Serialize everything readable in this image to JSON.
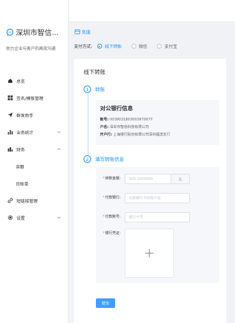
{
  "sidebar": {
    "brand_name": "深圳市智信...",
    "brand_sub": "助力企业与客户的高效沟通",
    "items": [
      {
        "label": "总览"
      },
      {
        "label": "签名/模板管理"
      },
      {
        "label": "群发助手"
      },
      {
        "label": "业务统计"
      },
      {
        "label": "财务"
      },
      {
        "label": "余额"
      },
      {
        "label": "日账单"
      },
      {
        "label": "短链接管理"
      },
      {
        "label": "设置"
      }
    ]
  },
  "breadcrumb": "充值",
  "payment": {
    "label": "支付方式:",
    "options": [
      {
        "label": "线下转账",
        "selected": true
      },
      {
        "label": "微信",
        "selected": false
      },
      {
        "label": "支付宝",
        "selected": false
      }
    ]
  },
  "card": {
    "title": "线下转账",
    "step1": {
      "num": "1",
      "label": "转账"
    },
    "bank": {
      "title": "对公银行信息",
      "account_label": "账号:",
      "account_value": "0039031803003970077",
      "name_label": "户名:",
      "name_value": "深圳市智信科技有限公司",
      "branch_label": "开户行:",
      "branch_value": "上海银行股份有限公司深圳福滨支行"
    },
    "step2": {
      "num": "2",
      "label": "填写转账信息"
    },
    "form": {
      "amount_label": "转账金额:",
      "amount_placeholder": "500-1000000",
      "amount_suffix": "元",
      "bank_label": "付款银行:",
      "bank_placeholder": "付款银行卡的账户名",
      "account_label": "付款账号:",
      "account_placeholder": "银行卡号",
      "voucher_label": "银行凭证:",
      "required_mark": "*"
    },
    "submit_label": "提交"
  },
  "colors": {
    "accent": "#1890ff",
    "button": "#409eff",
    "required": "#f56c6c"
  }
}
